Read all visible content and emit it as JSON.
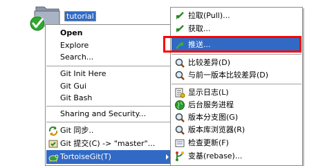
{
  "desktop": {
    "folder_label": "tutorial"
  },
  "context_menu": {
    "items": [
      {
        "label": "Open"
      },
      {
        "label": "Explore"
      },
      {
        "label": "Search..."
      },
      {
        "label": "Git Init Here"
      },
      {
        "label": "Git Gui"
      },
      {
        "label": "Git Bash"
      },
      {
        "label": "Sharing and Security..."
      },
      {
        "label": "Git 同步.."
      },
      {
        "label": "Git 提交(C) -> \"master\"..."
      },
      {
        "label": "TortoiseGit(T)"
      }
    ]
  },
  "tortoisegit_submenu": {
    "items": [
      {
        "label": "拉取(Pull)..."
      },
      {
        "label": "获取..."
      },
      {
        "label": "推送..."
      },
      {
        "label": "比较差异(D)"
      },
      {
        "label": "与前一版本比较差异(D)"
      },
      {
        "label": "显示日志(L)"
      },
      {
        "label": "后台服务进程"
      },
      {
        "label": "版本分支图(G)"
      },
      {
        "label": "版本库浏览器(R)"
      },
      {
        "label": "检查更新(F)"
      },
      {
        "label": "变基(rebase)..."
      }
    ]
  },
  "colors": {
    "highlight": "#316ac5",
    "annotation_box": "#ff0000",
    "overlay_check": "#2fa82f"
  }
}
